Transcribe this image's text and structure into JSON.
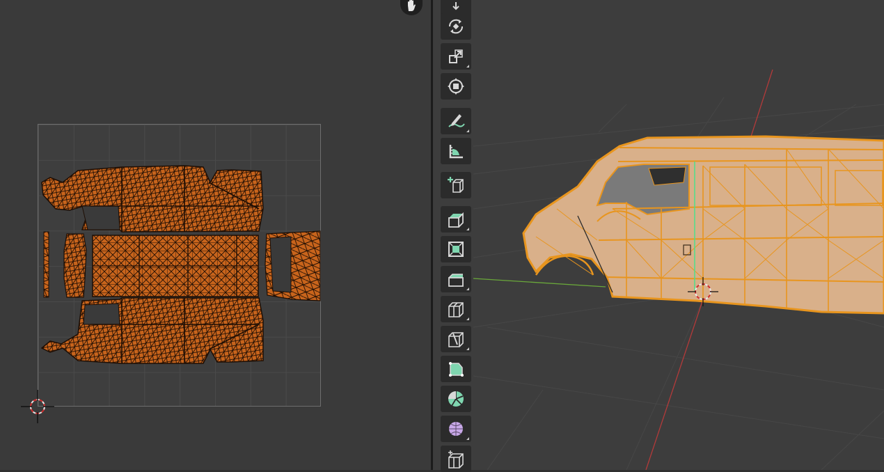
{
  "app": {
    "left_panel": "uv-editor",
    "right_panel": "3d-viewport"
  },
  "colors": {
    "uv_island_fill": "#c8641c",
    "uv_wire": "#1e0e04",
    "selected_orange": "#e8951e",
    "grid_line": "#4a4a4a",
    "axis_x": "#b33a3a",
    "axis_y": "#6aa83a",
    "tool_bg": "#2b2b2b",
    "tool_icon": "#d8d8d8",
    "tool_accent": "#7fd6b0"
  },
  "toolbar": {
    "tools": [
      {
        "name": "move-icon"
      },
      {
        "name": "rotate-icon"
      },
      {
        "name": "scale-icon"
      },
      {
        "name": "transform-icon"
      },
      {
        "name": "annotate-icon"
      },
      {
        "name": "measure-icon"
      },
      {
        "name": "add-cube-icon"
      },
      {
        "name": "extrude-region-icon"
      },
      {
        "name": "inset-faces-icon"
      },
      {
        "name": "bevel-icon"
      },
      {
        "name": "loop-cut-icon"
      },
      {
        "name": "knife-icon"
      },
      {
        "name": "poly-build-icon"
      },
      {
        "name": "spin-icon"
      },
      {
        "name": "smooth-icon"
      },
      {
        "name": "shear-icon"
      }
    ]
  },
  "viewport": {
    "object": "van-mesh",
    "mode": "edit-mode-wireframe"
  }
}
